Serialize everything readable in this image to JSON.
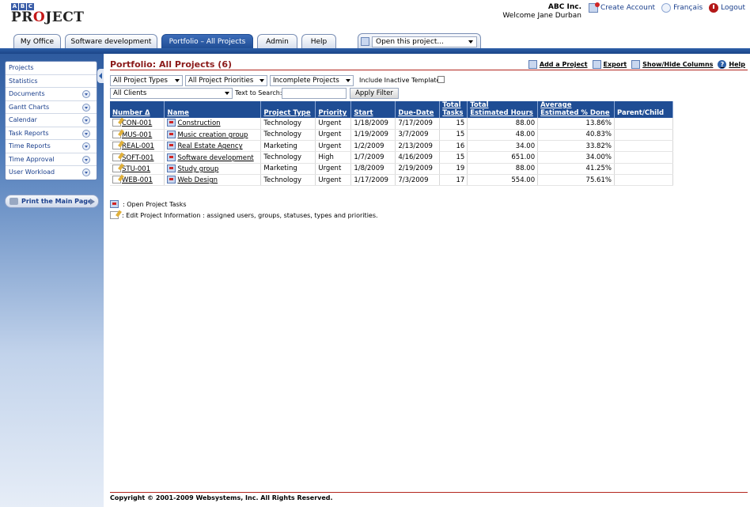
{
  "header": {
    "logo_letters": "ABC",
    "logo_word": "PROJECT",
    "company": "ABC Inc.",
    "welcome": "Welcome Jane Durban",
    "links": {
      "create_account": "Create Account",
      "language": "Français",
      "logout": "Logout"
    }
  },
  "tabs": [
    "My Office",
    "Software development",
    "Portfolio – All Projects",
    "Admin",
    "Help"
  ],
  "open_project": {
    "value": "Open this project..."
  },
  "sidebar": {
    "items": [
      {
        "label": "Projects"
      },
      {
        "label": "Statistics"
      },
      {
        "label": "Documents"
      },
      {
        "label": "Gantt Charts"
      },
      {
        "label": "Calendar"
      },
      {
        "label": "Task Reports"
      },
      {
        "label": "Time Reports"
      },
      {
        "label": "Time Approval"
      },
      {
        "label": "User Workload"
      }
    ],
    "print_button": "Print the Main Page"
  },
  "page": {
    "title": "Portfolio: All Projects (6)",
    "actions": {
      "add": "Add a Project",
      "export": "Export",
      "columns": "Show/Hide Columns",
      "help": "Help"
    }
  },
  "filters": {
    "project_types": "All Project Types",
    "priorities": "All Project Priorities",
    "status": "Incomplete Projects",
    "include_inactive": "Include Inactive Templates",
    "clients": "All Clients",
    "search_label": "Text to Search:",
    "search_value": "",
    "apply": "Apply Filter"
  },
  "table": {
    "columns": {
      "number": "Number Δ",
      "name": "Name",
      "type": "Project Type",
      "priority": "Priority",
      "start": "Start",
      "due": "Due-Date",
      "tasks_1": "Total",
      "tasks_2": "Tasks",
      "hours_1": "Total",
      "hours_2": "Estimated Hours",
      "done_1": "Average",
      "done_2": "Estimated % Done",
      "parent": "Parent/Child"
    },
    "rows": [
      {
        "number": "CON-001",
        "name": "Construction",
        "type": "Technology",
        "priority": "Urgent",
        "start": "1/18/2009",
        "due": "7/17/2009",
        "tasks": "15",
        "hours": "88.00",
        "done": "13.86%",
        "parent": ""
      },
      {
        "number": "MUS-001",
        "name": "Music creation group",
        "type": "Technology",
        "priority": "Urgent",
        "start": "1/19/2009",
        "due": "3/7/2009",
        "tasks": "15",
        "hours": "48.00",
        "done": "40.83%",
        "parent": ""
      },
      {
        "number": "REAL-001",
        "name": "Real Estate Agency",
        "type": "Marketing",
        "priority": "Urgent",
        "start": "1/2/2009",
        "due": "2/13/2009",
        "tasks": "16",
        "hours": "34.00",
        "done": "33.82%",
        "parent": ""
      },
      {
        "number": "SOFT-001",
        "name": "Software development",
        "type": "Technology",
        "priority": "High",
        "start": "1/7/2009",
        "due": "4/16/2009",
        "tasks": "15",
        "hours": "651.00",
        "done": "34.00%",
        "parent": ""
      },
      {
        "number": "STU-001",
        "name": "Study group",
        "type": "Marketing",
        "priority": "Urgent",
        "start": "1/8/2009",
        "due": "2/19/2009",
        "tasks": "19",
        "hours": "88.00",
        "done": "41.25%",
        "parent": ""
      },
      {
        "number": "WEB-001",
        "name": "Web Design",
        "type": "Technology",
        "priority": "Urgent",
        "start": "1/17/2009",
        "due": "7/3/2009",
        "tasks": "17",
        "hours": "554.00",
        "done": "75.61%",
        "parent": ""
      }
    ]
  },
  "legend": {
    "open_tasks": ": Open Project Tasks",
    "edit_info": ": Edit Project Information : assigned users, groups, statuses, types and priorities."
  },
  "footer": {
    "copyright": "Copyright © 2001-2009 Websystems, Inc. All Rights Reserved."
  },
  "colors": {
    "brand_blue": "#1f4d94",
    "title_red": "#8b1a1a",
    "rule_red": "#b3261e"
  }
}
